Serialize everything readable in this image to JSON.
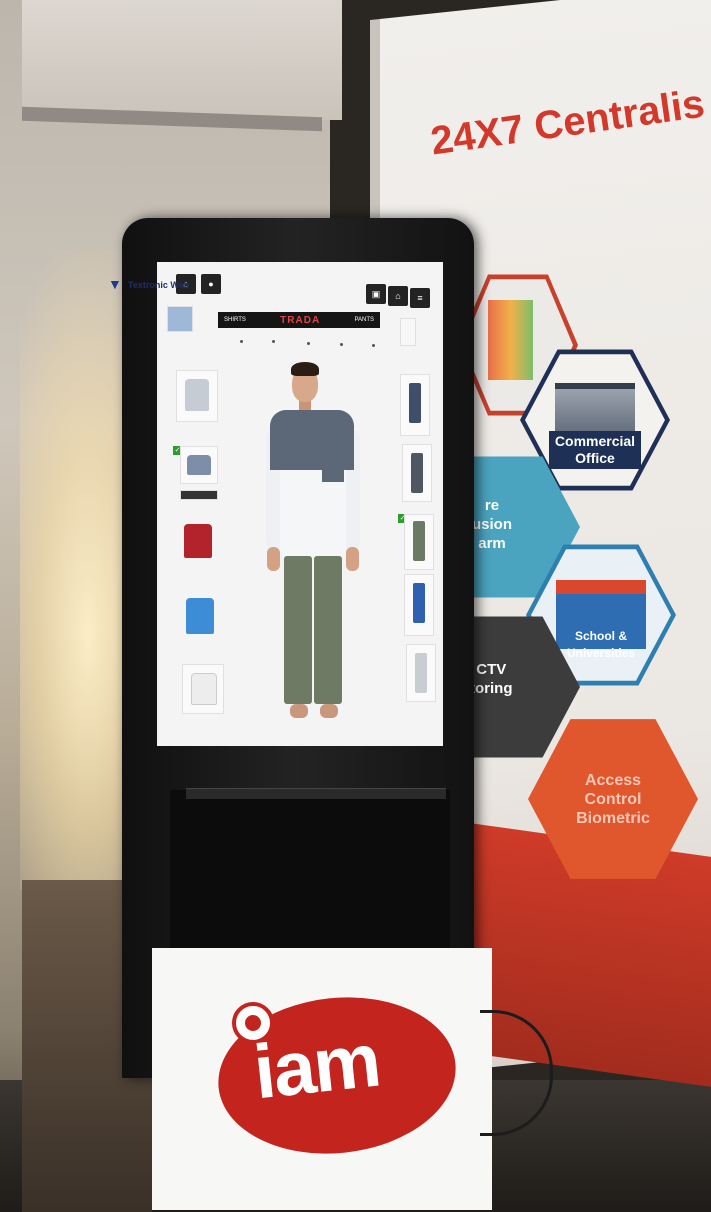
{
  "banner": {
    "title": "24X7 Centralis",
    "hexes": {
      "commercial_office": "Commercial\nOffice",
      "school": "School &\nUniversities",
      "access_control": "Access\nControl\nBiometric",
      "fire_fragment": "re\nusion\narm",
      "cctv_fragment": "CTV\ntoring"
    }
  },
  "kiosk_screen": {
    "logo_text": "Textronic Web",
    "menu_brand": "TRADA",
    "menu_left": "SHIRTS",
    "menu_right": "PANTS"
  },
  "sign": {
    "logo": "iam"
  },
  "colors": {
    "banner_red": "#d4382a",
    "hex_teal": "#4aa3bf",
    "hex_dark": "#3c3c3c",
    "hex_orange": "#e0572e",
    "iam_red": "#c4241e"
  }
}
